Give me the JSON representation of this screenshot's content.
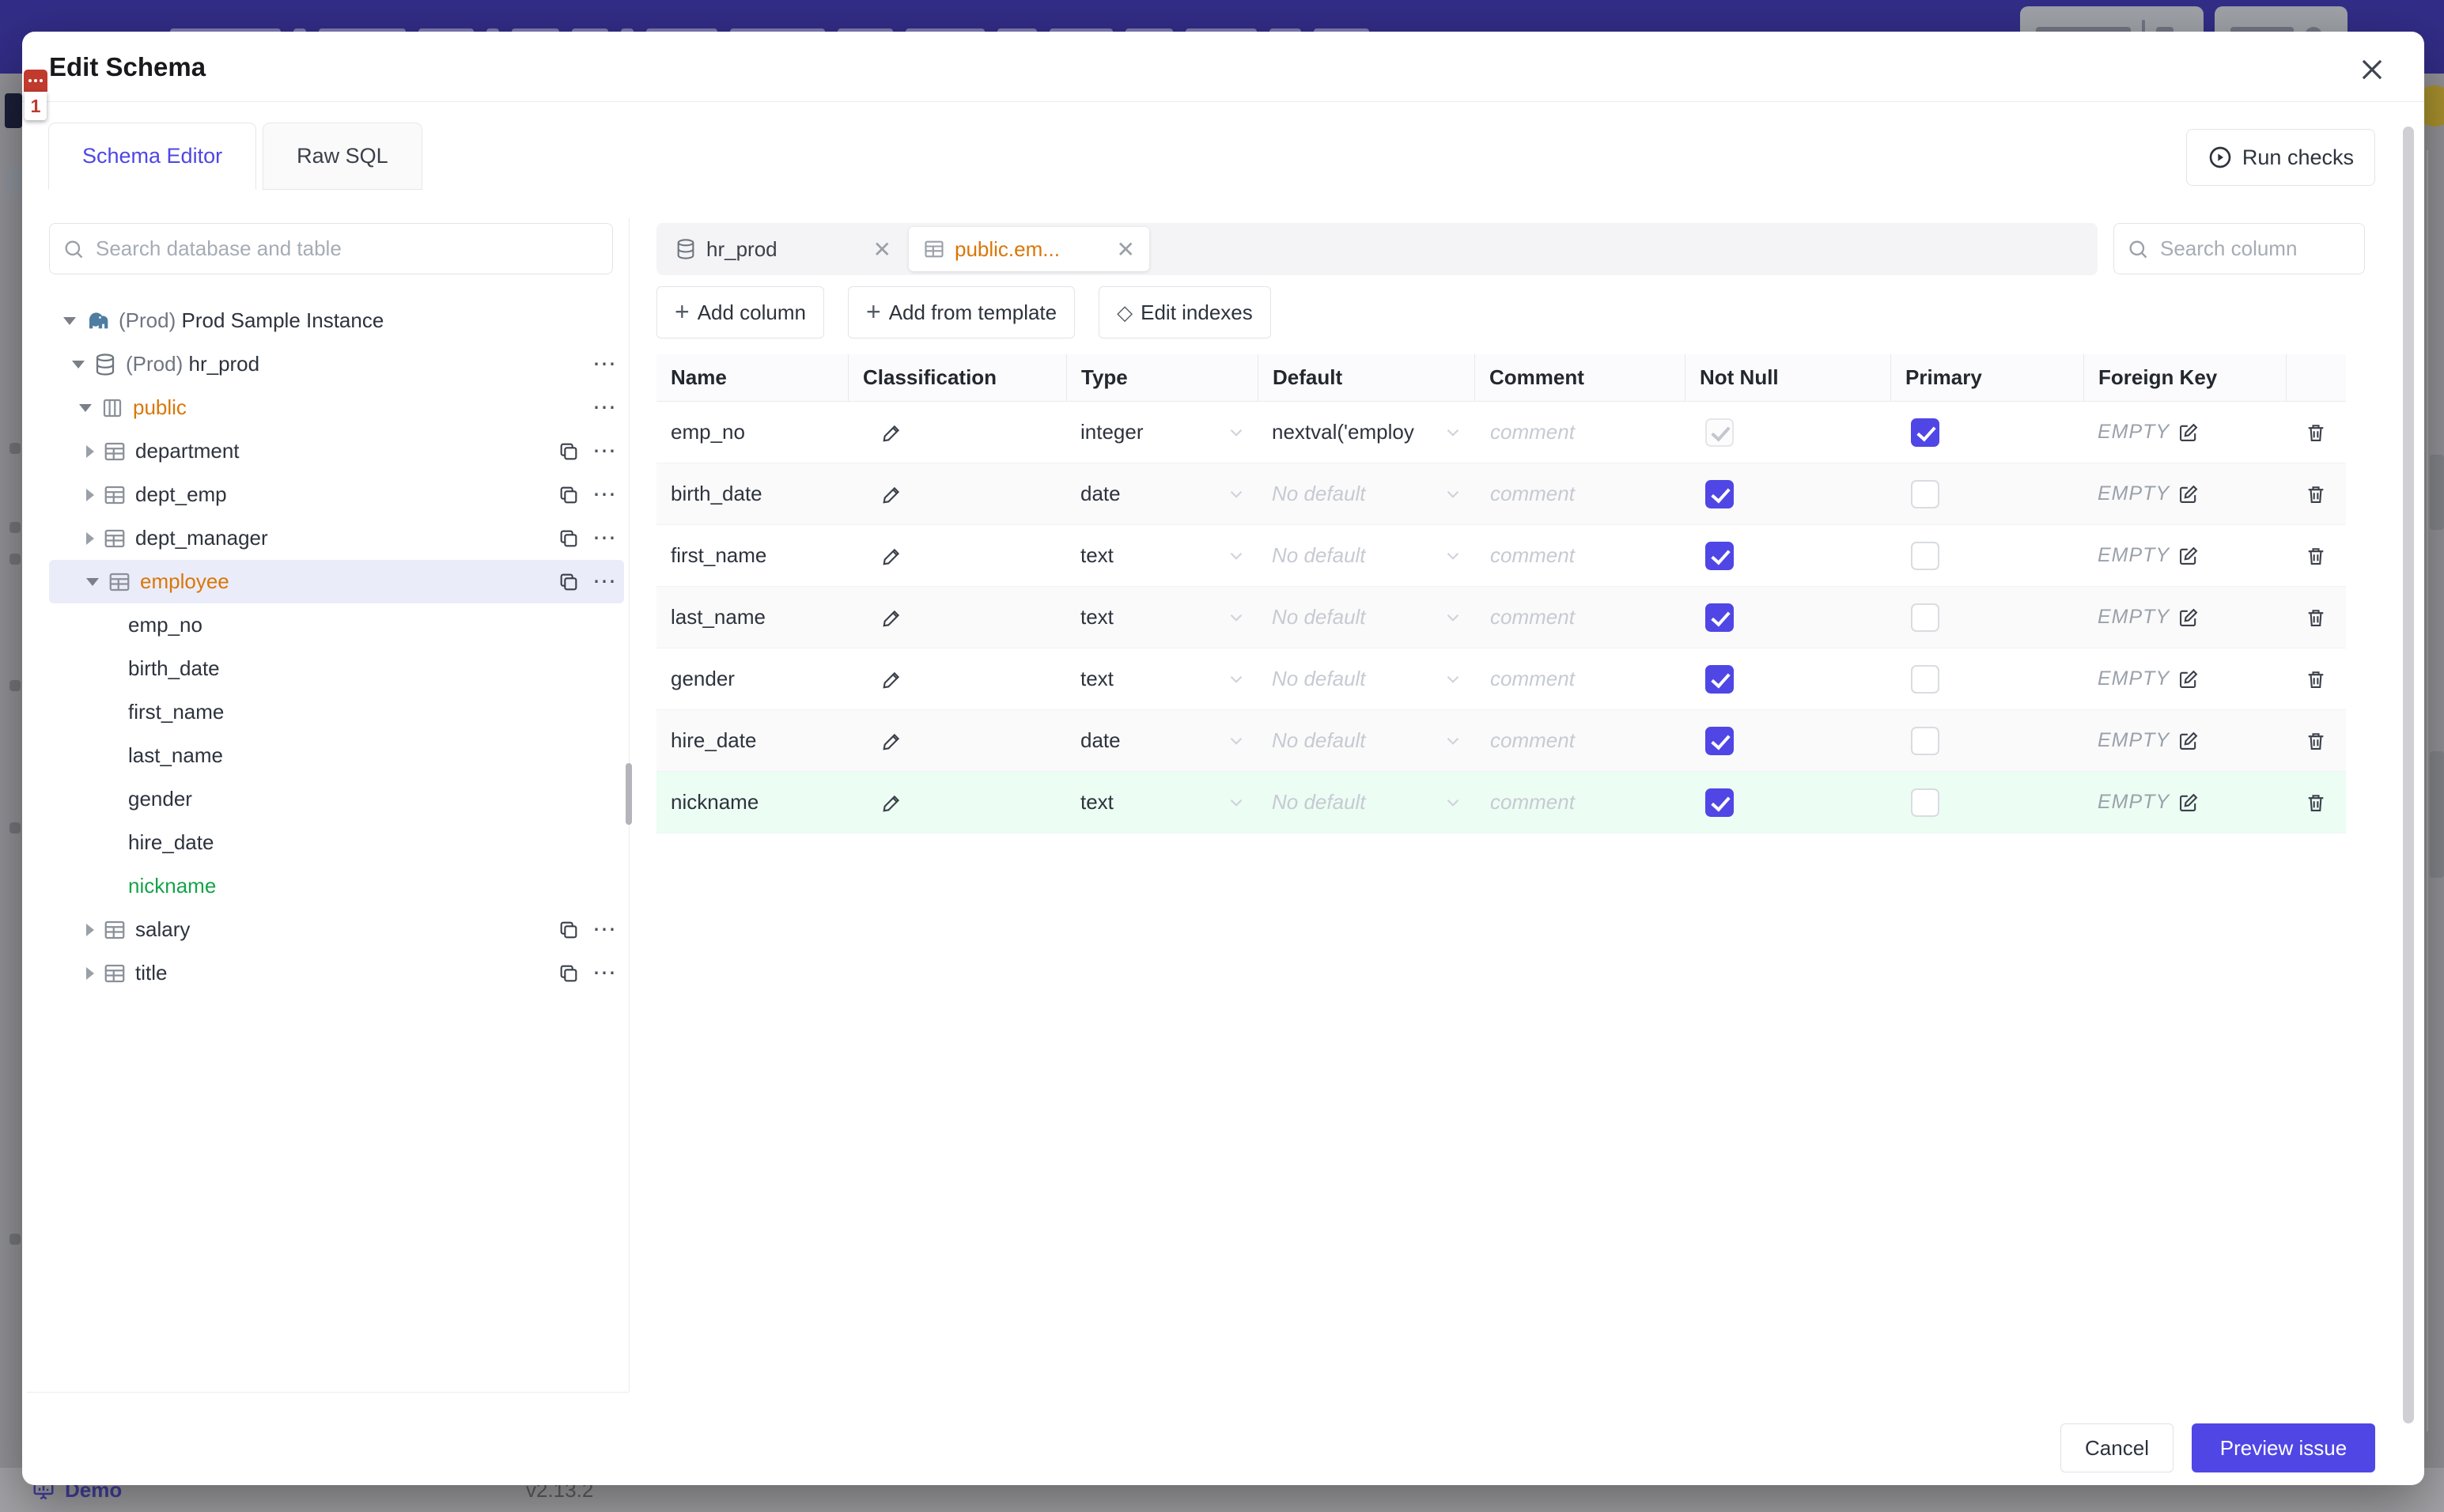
{
  "colors": {
    "accent": "#4f46e5",
    "modified_amber": "#d97706",
    "created_green": "#16a34a",
    "created_row_bg": "#ecfdf3",
    "selected_tree_bg": "#ebecfa",
    "topbar": "#322d87"
  },
  "backdrop": {
    "demo_label": "Demo",
    "version_label": "v2.13.2"
  },
  "modal": {
    "title": "Edit Schema",
    "tabs": {
      "schema_editor": "Schema Editor",
      "raw_sql": "Raw SQL"
    },
    "run_checks_label": "Run checks",
    "footer": {
      "cancel_label": "Cancel",
      "primary_label": "Preview issue"
    }
  },
  "sidebar": {
    "search_placeholder": "Search database and table",
    "tree": [
      {
        "prefix": "(Prod)",
        "label": "Prod Sample Instance",
        "type": "instance"
      },
      {
        "prefix": "(Prod)",
        "label": "hr_prod",
        "type": "database"
      },
      {
        "label": "public",
        "type": "schema",
        "state": "modified"
      },
      {
        "label": "department",
        "type": "table"
      },
      {
        "label": "dept_emp",
        "type": "table"
      },
      {
        "label": "dept_manager",
        "type": "table"
      },
      {
        "label": "employee",
        "type": "table",
        "state": "modified",
        "selected": true
      },
      {
        "label": "emp_no",
        "type": "column"
      },
      {
        "label": "birth_date",
        "type": "column"
      },
      {
        "label": "first_name",
        "type": "column"
      },
      {
        "label": "last_name",
        "type": "column"
      },
      {
        "label": "gender",
        "type": "column"
      },
      {
        "label": "hire_date",
        "type": "column"
      },
      {
        "label": "nickname",
        "type": "column",
        "state": "created"
      },
      {
        "label": "salary",
        "type": "table"
      },
      {
        "label": "title",
        "type": "table"
      }
    ]
  },
  "editor": {
    "tabs": [
      {
        "label": "hr_prod",
        "icon": "database"
      },
      {
        "label": "public.em...",
        "icon": "table",
        "active": true
      }
    ],
    "toolbar": {
      "add_column": "Add column",
      "add_from_template": "Add from template",
      "edit_indexes": "Edit indexes"
    },
    "column_search_placeholder": "Search column",
    "table": {
      "headers": [
        "Name",
        "Classification",
        "Type",
        "Default",
        "Comment",
        "Not Null",
        "Primary",
        "Foreign Key"
      ],
      "comment_placeholder": "comment",
      "no_default_placeholder": "No default",
      "foreign_key_value": "EMPTY",
      "rows": [
        {
          "name": "emp_no",
          "type": "integer",
          "default": "nextval('employ",
          "not_null": "checked_disabled",
          "primary": true,
          "created": false
        },
        {
          "name": "birth_date",
          "type": "date",
          "default": "No default",
          "not_null": "checked",
          "primary": false,
          "created": false
        },
        {
          "name": "first_name",
          "type": "text",
          "default": "No default",
          "not_null": "checked",
          "primary": false,
          "created": false
        },
        {
          "name": "last_name",
          "type": "text",
          "default": "No default",
          "not_null": "checked",
          "primary": false,
          "created": false
        },
        {
          "name": "gender",
          "type": "text",
          "default": "No default",
          "not_null": "checked",
          "primary": false,
          "created": false
        },
        {
          "name": "hire_date",
          "type": "date",
          "default": "No default",
          "not_null": "checked",
          "primary": false,
          "created": false
        },
        {
          "name": "nickname",
          "type": "text",
          "default": "No default",
          "not_null": "checked",
          "primary": false,
          "created": true
        }
      ]
    }
  }
}
